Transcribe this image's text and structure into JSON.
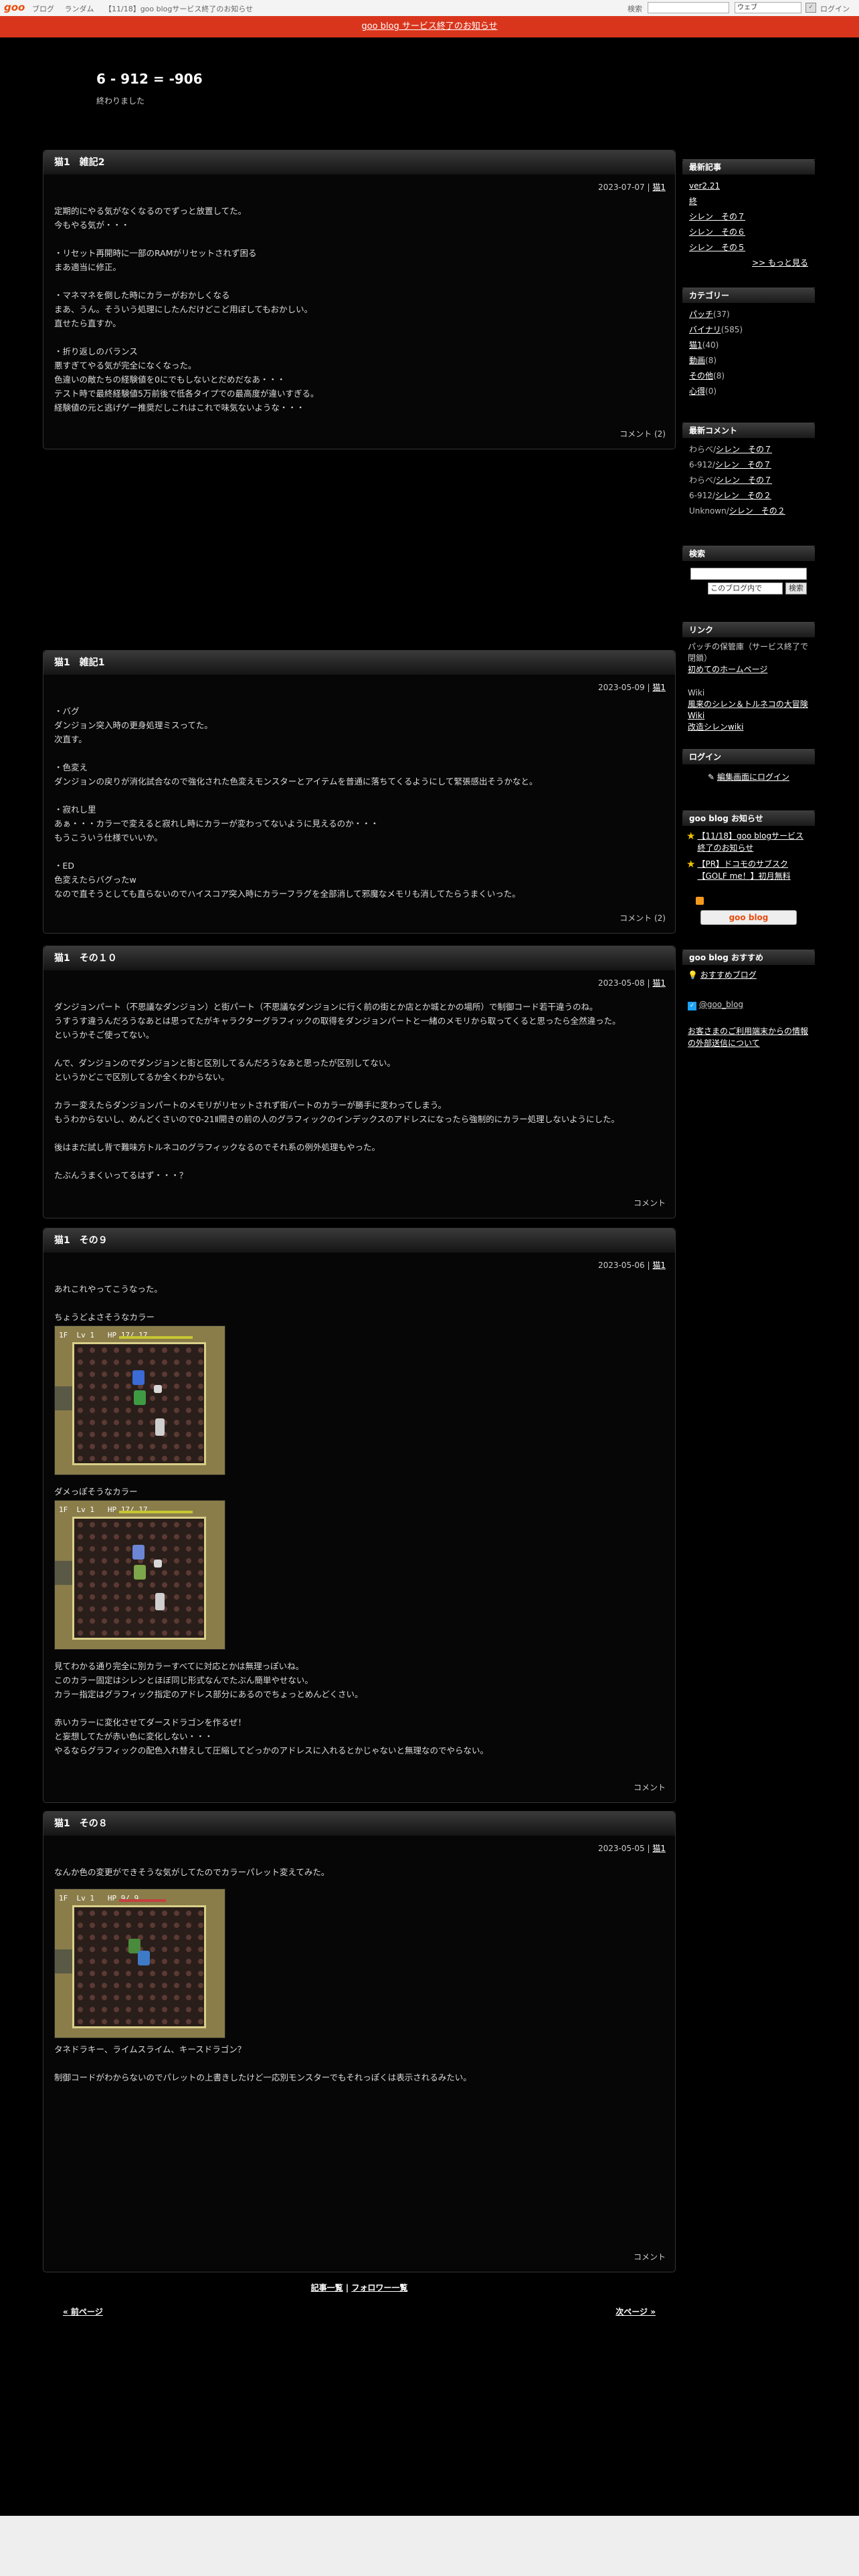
{
  "topbar": {
    "logo": "goo",
    "nav": [
      "ブログ",
      "ランダム",
      "【11/18】goo blogサービス終了のお知らせ"
    ],
    "search_label": "検索",
    "search_scope": "ウェブ",
    "search_go": "✓",
    "login": "ログイン"
  },
  "notice": "goo blog サービス終了のお知らせ",
  "blog": {
    "title": "6 - 912 = -906",
    "description": "終わりました"
  },
  "entries": [
    {
      "title": "猫1　雑記2",
      "date": "2023-07-07 | ",
      "category": "猫1",
      "lines": [
        "定期的にやる気がなくなるのでずっと放置してた。",
        "今もやる気が・・・",
        "",
        "・リセット再開時に一部のRAMがリセットされず困る",
        "まあ適当に修正。",
        "",
        "・マネマネを倒した時にカラーがおかしくなる",
        "まあ、うん。そういう処理にしたんだけどこど用ぼしてもおかしい。",
        "直せたら直すか。",
        "",
        "・折り返しのバランス",
        "悪すぎてやる気が完全になくなった。",
        "色違いの敵たちの経験値を0にでもしないとだめだなあ・・・",
        "テスト時で最終経験値5万前後で低各タイプでの最高度が違いすぎる。",
        "経験値の元と逃げゲー推奨だしこれはこれで味気ないような・・・"
      ],
      "footer": "コメント (2)"
    },
    {
      "title": "猫1　雑記1",
      "date": "2023-05-09 | ",
      "category": "猫1",
      "lines": [
        "・バグ",
        "ダンジョン突入時の更身処理ミスってた。",
        "次直す。",
        "",
        "・色変え",
        "ダンジョンの戻りが消化試合なので強化された色変えモンスターとアイテムを普通に落ちてくるようにして緊張感出そうかなと。",
        "",
        "・寂れし里",
        "あぁ・・・カラーで変えると寂れし時にカラーが変わってないように見えるのか・・・",
        "もうこういう仕様でいいか。",
        "",
        "・ED",
        "色変えたらバグったw",
        "なので直そうとしても直らないのでハイスコア突入時にカラーフラグを全部消して邪魔なメモリも消してたらうまくいった。"
      ],
      "footer": "コメント (2)"
    },
    {
      "title": "猫1　その１０",
      "date": "2023-05-08 | ",
      "category": "猫1",
      "lines": [
        "ダンジョンパート（不思議なダンジョン）と街パート（不思議なダンジョンに行く前の街とか店とか城とかの場所）で制御コード若干違うのね。",
        "うすうす違うんだろうなあとは思ってたがキャラクターグラフィックの取得をダンジョンパートと一緒のメモリから取ってくると思ったら全然違った。",
        "というかそご使ってない。",
        "",
        "んで、ダンジョンのでダンジョンと街と区別してるんだろうなあと思ったが区別してない。",
        "というかどこで区別してるか全くわからない。",
        "",
        "カラー変えたらダンジョンパートのメモリがリセットされず街パートのカラーが勝手に変わってしまう。",
        "もうわからないし、めんどくさいので0-21Ⅱ開きの前の人のグラフィックのインデックスのアドレスになったら強制的にカラー処理しないようにした。",
        "",
        "後はまだ試し背で難味方トルネコのグラフィックなるのでそれ系の例外処理もやった。",
        "",
        "たぶんうまくいってるはず・・・？"
      ],
      "footer": "コメント"
    },
    {
      "title": "猫1　その９",
      "date": "2023-05-06 | ",
      "category": "猫1",
      "intro": [
        "あれこれやってこうなった。",
        "",
        "ちょうどよさそうなカラー"
      ],
      "caption2": "ダメっぽそうなカラー",
      "hud1": "1F  Lv 1   HP 17/ 17",
      "hud2": "1F  Lv 1   HP 17/ 17",
      "lines": [
        "見てわかる通り完全に別カラーすべてに対応とかは無理っぽいね。",
        "このカラー固定はシレンとほぼ同じ形式なんでたぶん簡単やせない。",
        "カラー指定はグラフィック指定のアドレス部分にあるのでちょっとめんどくさい。",
        "",
        "赤いカラーに変化させてダースドラゴンを作るぜ！",
        "と妄想してたが赤い色に変化しない・・・",
        "やるならグラフィックの配色入れ替えして圧縮してどっかのアドレスに入れるとかじゃないと無理なのでやらない。"
      ],
      "footer": "コメント"
    },
    {
      "title": "猫1　その８",
      "date": "2023-05-05 | ",
      "category": "猫1",
      "intro": [
        "なんか色の変更ができそうな気がしてたのでカラーパレット変えてみた。"
      ],
      "hud1": "1F  Lv 1   HP 9/ 9",
      "lines": [
        "タネドラキー、ライムスライム、キースドラゴン？",
        "",
        "制御コードがわからないのでパレットの上書きしたけど一応別モンスターでもそれっぽくは表示されるみたい。"
      ],
      "footer": "コメント"
    }
  ],
  "pager": {
    "list": "記事一覧",
    "sep": " | ",
    "follower": "フォロワー一覧",
    "prev": "« 前ページ",
    "next": "次ページ »"
  },
  "sidebar": {
    "recent": {
      "title": "最新記事",
      "items": [
        "ver2.21",
        "終",
        "シレン　その７",
        "シレン　その６",
        "シレン　その５"
      ],
      "more": ">> もっと見る"
    },
    "categories": {
      "title": "カテゴリー",
      "items": [
        {
          "name": "パッチ",
          "count": "(37)"
        },
        {
          "name": "バイナリ",
          "count": "(585)"
        },
        {
          "name": "猫1",
          "count": "(40)"
        },
        {
          "name": "動画",
          "count": "(8)"
        },
        {
          "name": "その他",
          "count": "(8)"
        },
        {
          "name": "心得",
          "count": "(0)"
        }
      ]
    },
    "comments": {
      "title": "最新コメント",
      "items": [
        {
          "who": "わらべ/",
          "post": "シレン　その７"
        },
        {
          "who": "6-912/",
          "post": "シレン　その７"
        },
        {
          "who": "わらべ/",
          "post": "シレン　その７"
        },
        {
          "who": "6-912/",
          "post": "シレン　その２"
        },
        {
          "who": "Unknown/",
          "post": "シレン　その２"
        }
      ]
    },
    "search": {
      "title": "検索",
      "scope": "このブログ内で",
      "button": "検索"
    },
    "links": {
      "title": "リンク",
      "text1": "パッチの保管庫（サービス終了で閉鎖）",
      "link1": "初めてのホームページ",
      "wiki": "Wiki",
      "link2": "風来のシレン＆トルネコの大冒険 Wiki",
      "link3": "改造シレンwiki"
    },
    "login": {
      "title": "ログイン",
      "edit": "編集画面にログイン"
    },
    "goonews": {
      "title": "goo blog お知らせ",
      "item1": "【11/18】goo blogサービス終了のお知らせ",
      "item2": "【PR】ドコモのサブスク【GOLF me！】初月無料",
      "btn": "goo blog"
    },
    "recommend": {
      "title": "goo blog おすすめ",
      "item1": "おすすめブログ",
      "twitter": "@goo_blog",
      "contact": "お客さまのご利用端末からの情報の外部送信について"
    }
  }
}
